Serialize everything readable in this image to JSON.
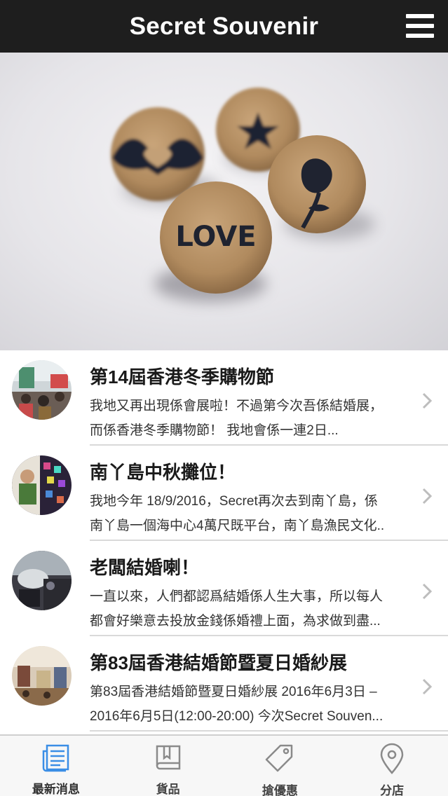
{
  "header": {
    "title": "Secret Souvenir",
    "menu_icon": "hamburger-menu-icon"
  },
  "hero": {
    "image": "cork-pins-photo",
    "pin_text": "LOVE"
  },
  "news": [
    {
      "title": "第14屆香港冬季購物節",
      "excerpt_line1": "我地又再出現係會展啦！不過第今次吾係結婚展，",
      "excerpt_line2": "而係香港冬季購物節！ 我地會係一連2日..."
    },
    {
      "title": "南丫島中秋攤位！",
      "excerpt_line1": "我地今年 18/9/2016，Secret再次去到南丫島，係",
      "excerpt_line2": "南丫島一個海中心4萬尺既平台，南丫島漁民文化.."
    },
    {
      "title": "老闆結婚喇！",
      "excerpt_line1": "一直以來，人們都認爲結婚係人生大事，所以每人",
      "excerpt_line2": "都會好樂意去投放金錢係婚禮上面，為求做到盡..."
    },
    {
      "title": "第83屆香港結婚節暨夏日婚紗展",
      "excerpt_line1": "第83屆香港結婚節暨夏日婚紗展 2016年6月3日 –",
      "excerpt_line2": "2016年6月5日(12:00-20:00) 今次Secret Souven..."
    }
  ],
  "tabs": [
    {
      "label": "最新消息",
      "icon": "newspaper-icon",
      "active": true
    },
    {
      "label": "貨品",
      "icon": "book-icon",
      "active": false
    },
    {
      "label": "搶優惠",
      "icon": "price-tag-icon",
      "active": false
    },
    {
      "label": "分店",
      "icon": "map-pin-icon",
      "active": false
    }
  ],
  "colors": {
    "header_bg": "#1e1e1e",
    "active_tab": "#3a8ee6",
    "inactive_tab": "#8a8a8a",
    "divider": "#d9d9d9"
  }
}
